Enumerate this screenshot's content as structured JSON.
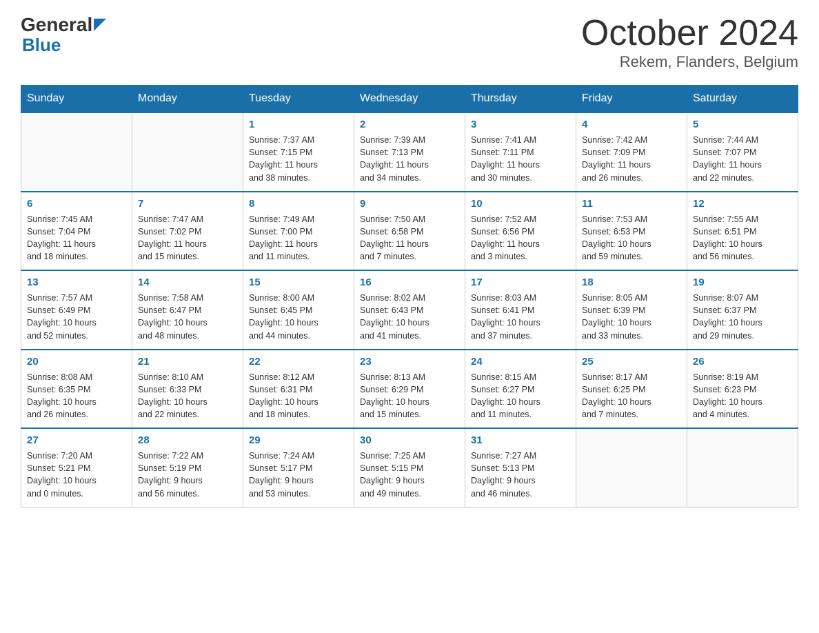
{
  "header": {
    "logo_general": "General",
    "logo_blue": "Blue",
    "month": "October 2024",
    "location": "Rekem, Flanders, Belgium"
  },
  "days_of_week": [
    "Sunday",
    "Monday",
    "Tuesday",
    "Wednesday",
    "Thursday",
    "Friday",
    "Saturday"
  ],
  "weeks": [
    [
      {
        "day": "",
        "info": ""
      },
      {
        "day": "",
        "info": ""
      },
      {
        "day": "1",
        "info": "Sunrise: 7:37 AM\nSunset: 7:15 PM\nDaylight: 11 hours\nand 38 minutes."
      },
      {
        "day": "2",
        "info": "Sunrise: 7:39 AM\nSunset: 7:13 PM\nDaylight: 11 hours\nand 34 minutes."
      },
      {
        "day": "3",
        "info": "Sunrise: 7:41 AM\nSunset: 7:11 PM\nDaylight: 11 hours\nand 30 minutes."
      },
      {
        "day": "4",
        "info": "Sunrise: 7:42 AM\nSunset: 7:09 PM\nDaylight: 11 hours\nand 26 minutes."
      },
      {
        "day": "5",
        "info": "Sunrise: 7:44 AM\nSunset: 7:07 PM\nDaylight: 11 hours\nand 22 minutes."
      }
    ],
    [
      {
        "day": "6",
        "info": "Sunrise: 7:45 AM\nSunset: 7:04 PM\nDaylight: 11 hours\nand 18 minutes."
      },
      {
        "day": "7",
        "info": "Sunrise: 7:47 AM\nSunset: 7:02 PM\nDaylight: 11 hours\nand 15 minutes."
      },
      {
        "day": "8",
        "info": "Sunrise: 7:49 AM\nSunset: 7:00 PM\nDaylight: 11 hours\nand 11 minutes."
      },
      {
        "day": "9",
        "info": "Sunrise: 7:50 AM\nSunset: 6:58 PM\nDaylight: 11 hours\nand 7 minutes."
      },
      {
        "day": "10",
        "info": "Sunrise: 7:52 AM\nSunset: 6:56 PM\nDaylight: 11 hours\nand 3 minutes."
      },
      {
        "day": "11",
        "info": "Sunrise: 7:53 AM\nSunset: 6:53 PM\nDaylight: 10 hours\nand 59 minutes."
      },
      {
        "day": "12",
        "info": "Sunrise: 7:55 AM\nSunset: 6:51 PM\nDaylight: 10 hours\nand 56 minutes."
      }
    ],
    [
      {
        "day": "13",
        "info": "Sunrise: 7:57 AM\nSunset: 6:49 PM\nDaylight: 10 hours\nand 52 minutes."
      },
      {
        "day": "14",
        "info": "Sunrise: 7:58 AM\nSunset: 6:47 PM\nDaylight: 10 hours\nand 48 minutes."
      },
      {
        "day": "15",
        "info": "Sunrise: 8:00 AM\nSunset: 6:45 PM\nDaylight: 10 hours\nand 44 minutes."
      },
      {
        "day": "16",
        "info": "Sunrise: 8:02 AM\nSunset: 6:43 PM\nDaylight: 10 hours\nand 41 minutes."
      },
      {
        "day": "17",
        "info": "Sunrise: 8:03 AM\nSunset: 6:41 PM\nDaylight: 10 hours\nand 37 minutes."
      },
      {
        "day": "18",
        "info": "Sunrise: 8:05 AM\nSunset: 6:39 PM\nDaylight: 10 hours\nand 33 minutes."
      },
      {
        "day": "19",
        "info": "Sunrise: 8:07 AM\nSunset: 6:37 PM\nDaylight: 10 hours\nand 29 minutes."
      }
    ],
    [
      {
        "day": "20",
        "info": "Sunrise: 8:08 AM\nSunset: 6:35 PM\nDaylight: 10 hours\nand 26 minutes."
      },
      {
        "day": "21",
        "info": "Sunrise: 8:10 AM\nSunset: 6:33 PM\nDaylight: 10 hours\nand 22 minutes."
      },
      {
        "day": "22",
        "info": "Sunrise: 8:12 AM\nSunset: 6:31 PM\nDaylight: 10 hours\nand 18 minutes."
      },
      {
        "day": "23",
        "info": "Sunrise: 8:13 AM\nSunset: 6:29 PM\nDaylight: 10 hours\nand 15 minutes."
      },
      {
        "day": "24",
        "info": "Sunrise: 8:15 AM\nSunset: 6:27 PM\nDaylight: 10 hours\nand 11 minutes."
      },
      {
        "day": "25",
        "info": "Sunrise: 8:17 AM\nSunset: 6:25 PM\nDaylight: 10 hours\nand 7 minutes."
      },
      {
        "day": "26",
        "info": "Sunrise: 8:19 AM\nSunset: 6:23 PM\nDaylight: 10 hours\nand 4 minutes."
      }
    ],
    [
      {
        "day": "27",
        "info": "Sunrise: 7:20 AM\nSunset: 5:21 PM\nDaylight: 10 hours\nand 0 minutes."
      },
      {
        "day": "28",
        "info": "Sunrise: 7:22 AM\nSunset: 5:19 PM\nDaylight: 9 hours\nand 56 minutes."
      },
      {
        "day": "29",
        "info": "Sunrise: 7:24 AM\nSunset: 5:17 PM\nDaylight: 9 hours\nand 53 minutes."
      },
      {
        "day": "30",
        "info": "Sunrise: 7:25 AM\nSunset: 5:15 PM\nDaylight: 9 hours\nand 49 minutes."
      },
      {
        "day": "31",
        "info": "Sunrise: 7:27 AM\nSunset: 5:13 PM\nDaylight: 9 hours\nand 46 minutes."
      },
      {
        "day": "",
        "info": ""
      },
      {
        "day": "",
        "info": ""
      }
    ]
  ]
}
